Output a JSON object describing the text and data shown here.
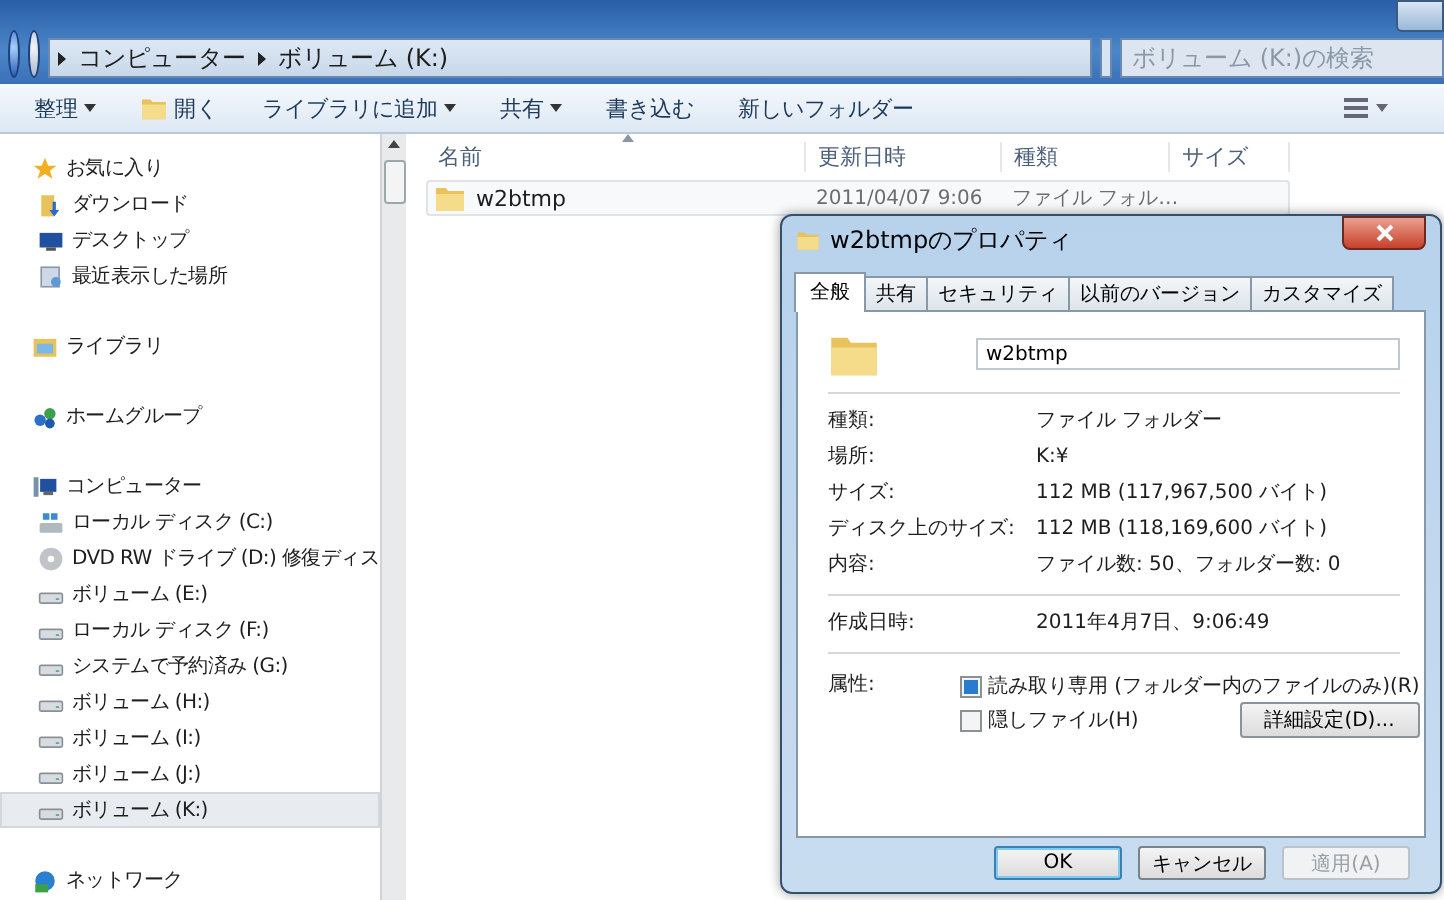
{
  "window": {
    "breadcrumb": [
      "コンピューター",
      "ボリューム (K:)"
    ],
    "search": {
      "placeholder": "ボリューム (K:)の検索"
    }
  },
  "toolbar": [
    {
      "label": "整理",
      "kind": "menu"
    },
    {
      "label": "開く",
      "kind": "icon-button"
    },
    {
      "label": "ライブラリに追加",
      "kind": "menu"
    },
    {
      "label": "共有",
      "kind": "menu"
    },
    {
      "label": "書き込む",
      "kind": "button"
    },
    {
      "label": "新しいフォルダー",
      "kind": "button"
    }
  ],
  "navigation": [
    {
      "label": "お気に入り",
      "kind": "favorites",
      "selected": false,
      "children": [
        {
          "label": "ダウンロード",
          "kind": "download",
          "selected": false
        },
        {
          "label": "デスクトップ",
          "kind": "desktop",
          "selected": false
        },
        {
          "label": "最近表示した場所",
          "kind": "recent",
          "selected": false
        }
      ]
    },
    {
      "label": "ライブラリ",
      "kind": "library",
      "selected": false
    },
    {
      "label": "ホームグループ",
      "kind": "homegroup",
      "selected": false
    },
    {
      "label": "コンピューター",
      "kind": "computer",
      "selected": false,
      "children": [
        {
          "label": "ローカル ディスク (C:)",
          "kind": "system-disk",
          "selected": false
        },
        {
          "label": "DVD RW ドライブ (D:) 修復ディス",
          "kind": "dvd",
          "selected": false
        },
        {
          "label": "ボリューム (E:)",
          "kind": "drive",
          "selected": false
        },
        {
          "label": "ローカル ディスク (F:)",
          "kind": "drive",
          "selected": false
        },
        {
          "label": "システムで予約済み (G:)",
          "kind": "drive",
          "selected": false
        },
        {
          "label": "ボリューム (H:)",
          "kind": "drive",
          "selected": false
        },
        {
          "label": "ボリューム (I:)",
          "kind": "drive",
          "selected": false
        },
        {
          "label": "ボリューム (J:)",
          "kind": "drive",
          "selected": false
        },
        {
          "label": "ボリューム (K:)",
          "kind": "drive",
          "selected": true
        }
      ]
    },
    {
      "label": "ネットワーク",
      "kind": "network",
      "selected": false
    }
  ],
  "columns": [
    {
      "label": "名前",
      "sorted": true
    },
    {
      "label": "更新日時",
      "sorted": false
    },
    {
      "label": "種類",
      "sorted": false
    },
    {
      "label": "サイズ",
      "sorted": false
    }
  ],
  "files": [
    {
      "name": "w2btmp",
      "modified": "2011/04/07 9:06",
      "type": "ファイル フォル…"
    }
  ],
  "dialog": {
    "title": "w2btmpのプロパティ",
    "tabs": [
      {
        "label": "全般",
        "selected": true
      },
      {
        "label": "共有",
        "selected": false
      },
      {
        "label": "セキュリティ",
        "selected": false
      },
      {
        "label": "以前のバージョン",
        "selected": false
      },
      {
        "label": "カスタマイズ",
        "selected": false
      }
    ],
    "name_value": "w2btmp",
    "sections": [
      [
        {
          "label": "種類:",
          "value": "ファイル フォルダー"
        },
        {
          "label": "場所:",
          "value": "K:¥"
        },
        {
          "label": "サイズ:",
          "value": "112 MB (117,967,500 バイト)"
        },
        {
          "label": "ディスク上のサイズ:",
          "value": "112 MB (118,169,600 バイト)"
        },
        {
          "label": "内容:",
          "value": "ファイル数: 50、フォルダー数: 0"
        }
      ],
      [
        {
          "label": "作成日時:",
          "value": "2011年4月7日、9:06:49"
        }
      ]
    ],
    "attributes_label": "属性:",
    "attributes": [
      {
        "label": "読み取り専用 (フォルダー内のファイルのみ)(R)",
        "checked": false,
        "indeterminate": true
      },
      {
        "label": "隠しファイル(H)",
        "checked": false,
        "indeterminate": false
      }
    ],
    "advanced_button": "詳細設定(D)...",
    "buttons": [
      {
        "label": "OK",
        "kind": "default",
        "disabled": false
      },
      {
        "label": "キャンセル",
        "kind": "normal",
        "disabled": false
      },
      {
        "label": "適用(A)",
        "kind": "normal",
        "disabled": true
      }
    ]
  }
}
